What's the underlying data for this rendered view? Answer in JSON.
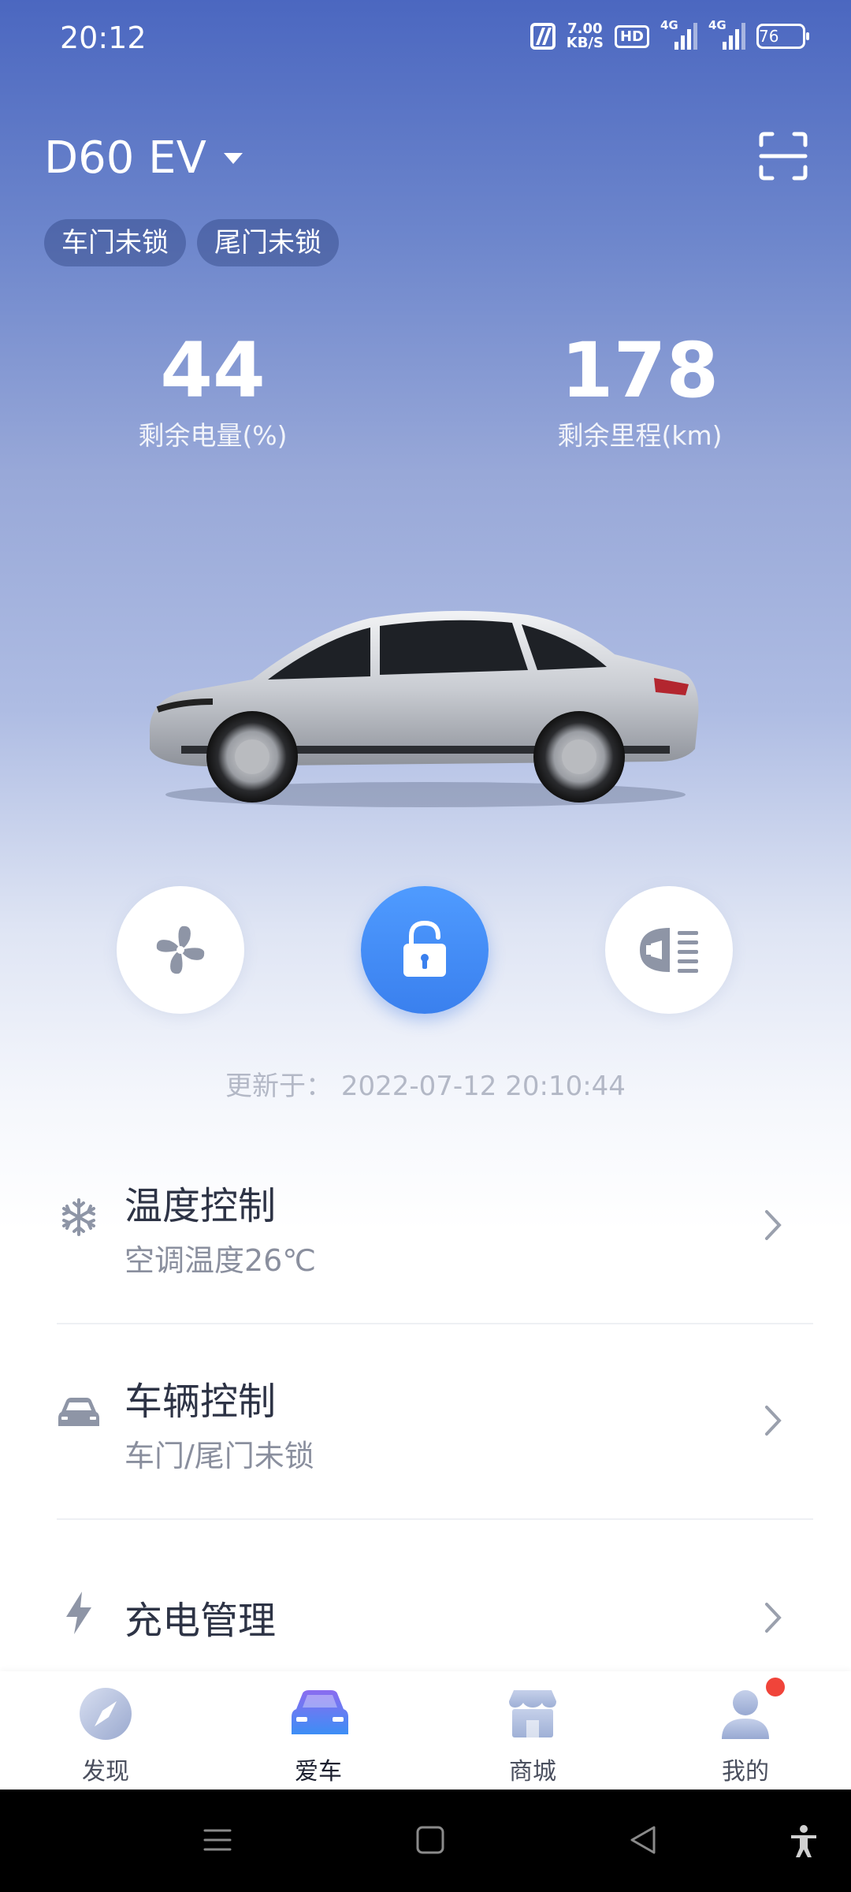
{
  "status_bar": {
    "time": "20:12",
    "speed_value": "7.00",
    "speed_unit": "KB/S",
    "hd_label": "HD",
    "net1": "4G",
    "net2": "4G",
    "battery": "76"
  },
  "header": {
    "car_name": "D60 EV",
    "tags": [
      "车门未锁",
      "尾门未锁"
    ]
  },
  "stats": {
    "battery_value": "44",
    "battery_label": "剩余电量(%)",
    "range_value": "178",
    "range_label": "剩余里程(km)"
  },
  "controls": {
    "updated_text": "更新于：  2022-07-12 20:10:44"
  },
  "list": {
    "temp": {
      "title": "温度控制",
      "subtitle": "空调温度26℃"
    },
    "vehicle": {
      "title": "车辆控制",
      "subtitle": "车门/尾门未锁"
    },
    "charge": {
      "title": "充电管理"
    }
  },
  "bottom_nav": {
    "items": [
      {
        "label": "发现"
      },
      {
        "label": "爱车"
      },
      {
        "label": "商城"
      },
      {
        "label": "我的"
      }
    ],
    "active": "爱车"
  },
  "colors": {
    "accent": "#3a80ee",
    "header_bg": "#4b67c0",
    "badge": "#f0443a"
  }
}
